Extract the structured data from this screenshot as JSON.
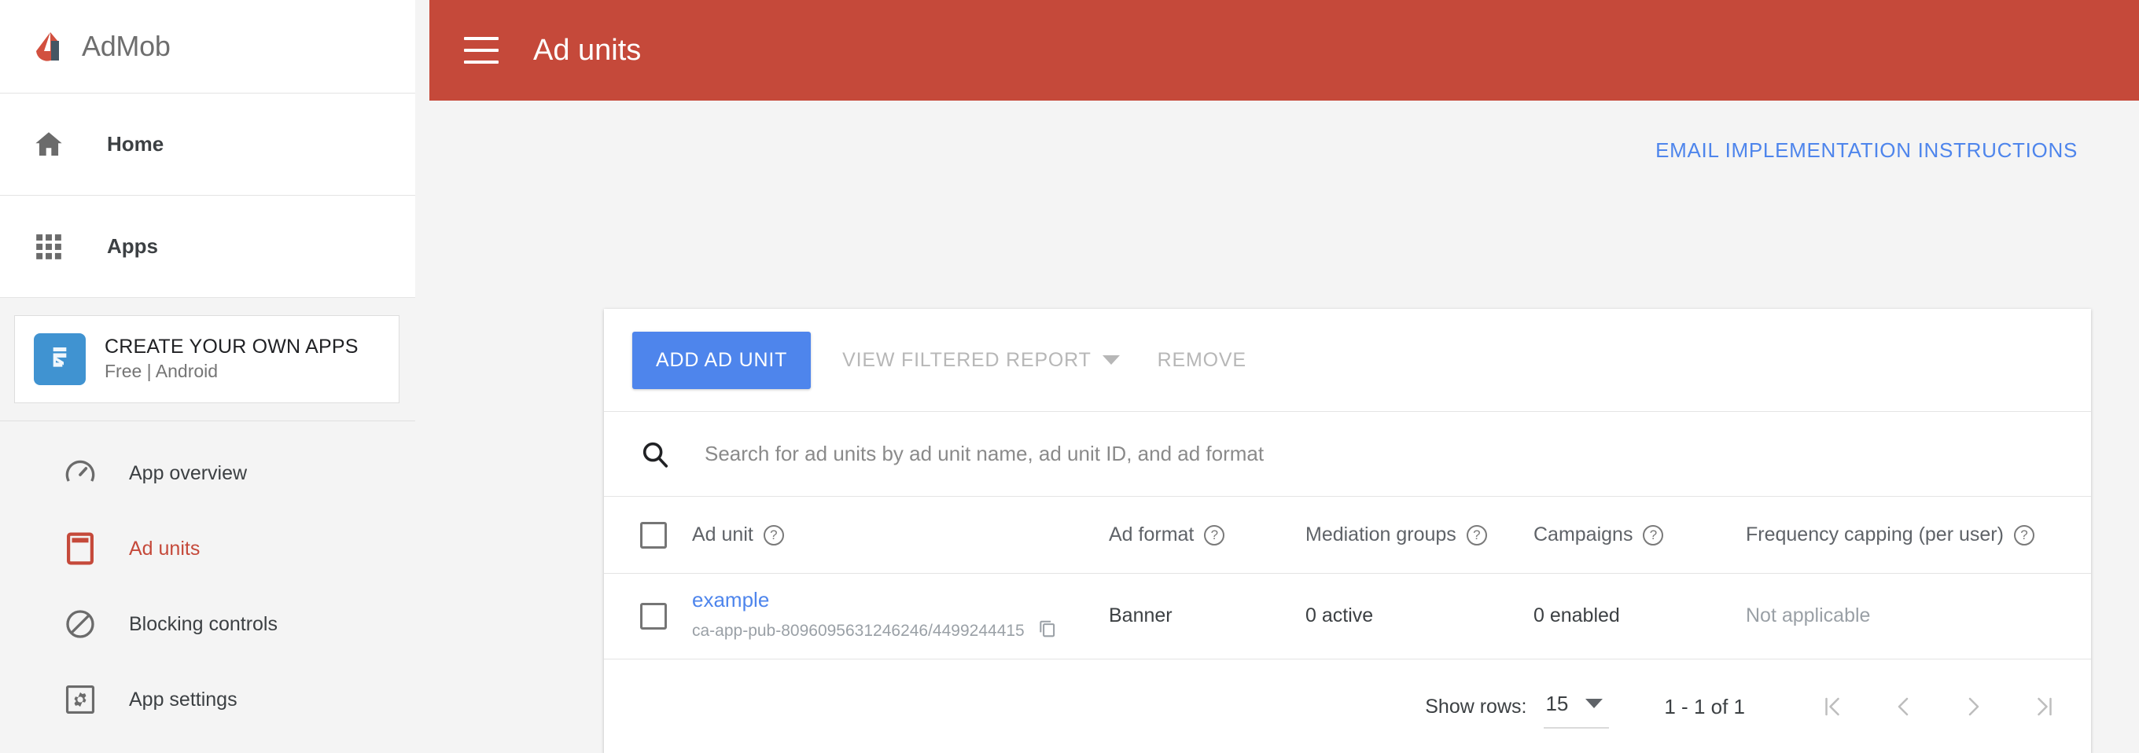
{
  "brand": {
    "name": "AdMob",
    "logo_icon": "admob-logo-icon"
  },
  "sidebar": {
    "nav": [
      {
        "label": "Home",
        "icon": "home-icon"
      },
      {
        "label": "Apps",
        "icon": "apps-grid-icon"
      }
    ],
    "promo": {
      "title": "CREATE YOUR OWN APPS",
      "subtitle": "Free | Android",
      "icon": "app-promo-icon"
    },
    "subnav": [
      {
        "label": "App overview",
        "icon": "speedometer-icon",
        "active": false
      },
      {
        "label": "Ad units",
        "icon": "ad-unit-phone-icon",
        "active": true
      },
      {
        "label": "Blocking controls",
        "icon": "block-circle-icon",
        "active": false
      },
      {
        "label": "App settings",
        "icon": "settings-gear-icon",
        "active": false
      }
    ]
  },
  "topbar": {
    "menu_icon": "hamburger-menu-icon",
    "title": "Ad units"
  },
  "content": {
    "email_link": "EMAIL IMPLEMENTATION INSTRUCTIONS",
    "toolbar": {
      "add_label": "ADD AD UNIT",
      "view_report_label": "VIEW FILTERED REPORT",
      "remove_label": "REMOVE"
    },
    "search": {
      "placeholder": "Search for ad units by ad unit name, ad unit ID, and ad format",
      "value": "",
      "icon": "search-icon"
    },
    "table": {
      "columns": [
        {
          "label": "Ad unit",
          "help": "?"
        },
        {
          "label": "Ad format",
          "help": "?"
        },
        {
          "label": "Mediation groups",
          "help": "?"
        },
        {
          "label": "Campaigns",
          "help": "?"
        },
        {
          "label": "Frequency capping (per user)",
          "help": "?"
        }
      ],
      "rows": [
        {
          "name": "example",
          "id": "ca-app-pub-8096095631246246/4499244415",
          "copy_icon": "copy-icon",
          "ad_format": "Banner",
          "mediation_groups": "0 active",
          "campaigns": "0 enabled",
          "frequency_capping": "Not applicable"
        }
      ]
    },
    "footer": {
      "show_rows_label": "Show rows:",
      "rows_value": "15",
      "range_label": "1 - 1 of 1",
      "first_page_icon": "first-page-icon",
      "prev_page_icon": "prev-page-icon",
      "next_page_icon": "next-page-icon",
      "last_page_icon": "last-page-icon"
    }
  },
  "colors": {
    "header_red": "#c5493a",
    "accent_blue": "#4e85ec",
    "page_bg": "#f4f4f4",
    "active_red": "#c5493a"
  }
}
